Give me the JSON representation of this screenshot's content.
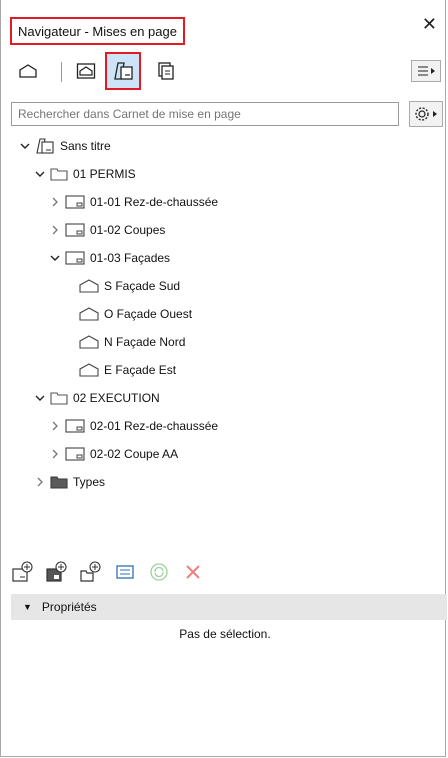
{
  "window": {
    "title": "Navigateur - Mises en page"
  },
  "toolbar": {
    "buttons": [
      {
        "name": "project-map-icon"
      },
      {
        "name": "view-map-icon"
      },
      {
        "name": "layout-book-icon"
      },
      {
        "name": "publisher-sets-icon"
      }
    ]
  },
  "search": {
    "placeholder": "Rechercher dans Carnet de mise en page"
  },
  "tree": {
    "root": "Sans titre",
    "items": [
      {
        "label": "01 PERMIS"
      },
      {
        "label": "01-01 Rez-de-chaussée"
      },
      {
        "label": "01-02 Coupes"
      },
      {
        "label": "01-03 Façades"
      },
      {
        "label": "S Façade Sud"
      },
      {
        "label": "O Façade Ouest"
      },
      {
        "label": "N Façade Nord"
      },
      {
        "label": "E Façade Est"
      },
      {
        "label": "02 EXECUTION"
      },
      {
        "label": "02-01 Rez-de-chaussée"
      },
      {
        "label": "02-02 Coupe AA"
      },
      {
        "label": "Types"
      }
    ]
  },
  "properties": {
    "header": "Propriétés",
    "empty_text": "Pas de sélection."
  },
  "colors": {
    "highlight": "#e01b24",
    "selected_bg": "#cde3f7",
    "accent_green": "#9ad29a",
    "delete_red": "#f08080"
  }
}
